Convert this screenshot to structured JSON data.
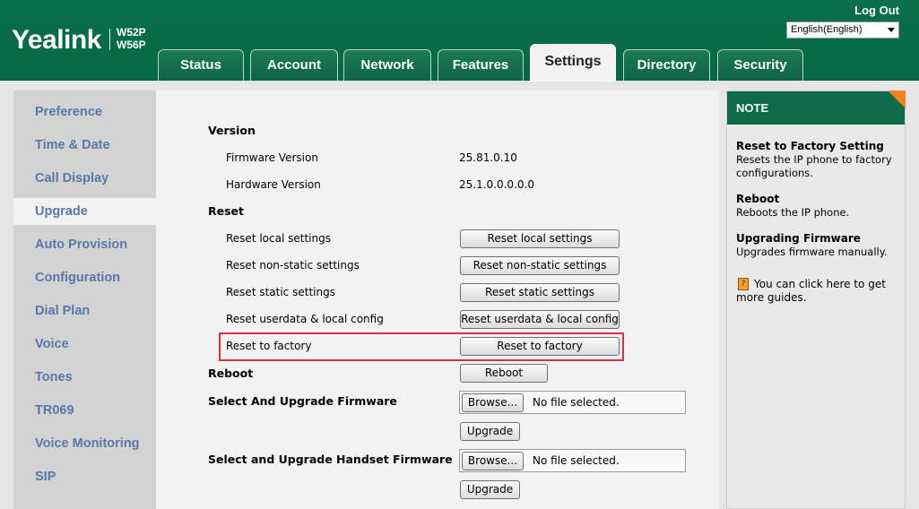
{
  "header": {
    "logo": "Yealink",
    "models": [
      "W52P",
      "W56P"
    ],
    "logout_label": "Log Out",
    "language_selected": "English(English)"
  },
  "tabs": [
    {
      "label": "Status",
      "active": false
    },
    {
      "label": "Account",
      "active": false
    },
    {
      "label": "Network",
      "active": false
    },
    {
      "label": "Features",
      "active": false
    },
    {
      "label": "Settings",
      "active": true
    },
    {
      "label": "Directory",
      "active": false
    },
    {
      "label": "Security",
      "active": false
    }
  ],
  "sidebar": {
    "items": [
      {
        "label": "Preference"
      },
      {
        "label": "Time & Date"
      },
      {
        "label": "Call Display"
      },
      {
        "label": "Upgrade",
        "active": true
      },
      {
        "label": "Auto Provision"
      },
      {
        "label": "Configuration"
      },
      {
        "label": "Dial Plan"
      },
      {
        "label": "Voice"
      },
      {
        "label": "Tones"
      },
      {
        "label": "TR069"
      },
      {
        "label": "Voice Monitoring"
      },
      {
        "label": "SIP"
      }
    ]
  },
  "main": {
    "version": {
      "heading": "Version",
      "firmware_label": "Firmware Version",
      "firmware_value": "25.81.0.10",
      "hardware_label": "Hardware Version",
      "hardware_value": "25.1.0.0.0.0.0"
    },
    "reset": {
      "heading": "Reset",
      "rows": [
        {
          "label": "Reset local settings",
          "button": "Reset local settings"
        },
        {
          "label": "Reset non-static settings",
          "button": "Reset non-static settings"
        },
        {
          "label": "Reset static settings",
          "button": "Reset static settings"
        },
        {
          "label": "Reset userdata & local config",
          "button": "Reset userdata & local config"
        },
        {
          "label": "Reset to factory",
          "button": "Reset to factory"
        }
      ]
    },
    "reboot": {
      "heading": "Reboot",
      "button": "Reboot"
    },
    "firmware_upgrade": {
      "heading": "Select And Upgrade Firmware",
      "browse_label": "Browse...",
      "file_status": "No file selected.",
      "upgrade_label": "Upgrade"
    },
    "handset_upgrade": {
      "heading": "Select and Upgrade Handset Firmware",
      "browse_label": "Browse...",
      "file_status": "No file selected.",
      "upgrade_label": "Upgrade"
    }
  },
  "note": {
    "title": "NOTE",
    "sections": [
      {
        "title": "Reset to Factory Setting",
        "body": "Resets the IP phone to factory configurations."
      },
      {
        "title": "Reboot",
        "body": "Reboots the IP phone."
      },
      {
        "title": "Upgrading Firmware",
        "body": "Upgrades firmware manually."
      }
    ],
    "guide_text": "You can click here to get more guides."
  },
  "colors": {
    "header_green": "#0a7049",
    "sidebar_link": "#5778a9",
    "highlight_red": "#d9333f",
    "note_corner": "#f3821f"
  }
}
